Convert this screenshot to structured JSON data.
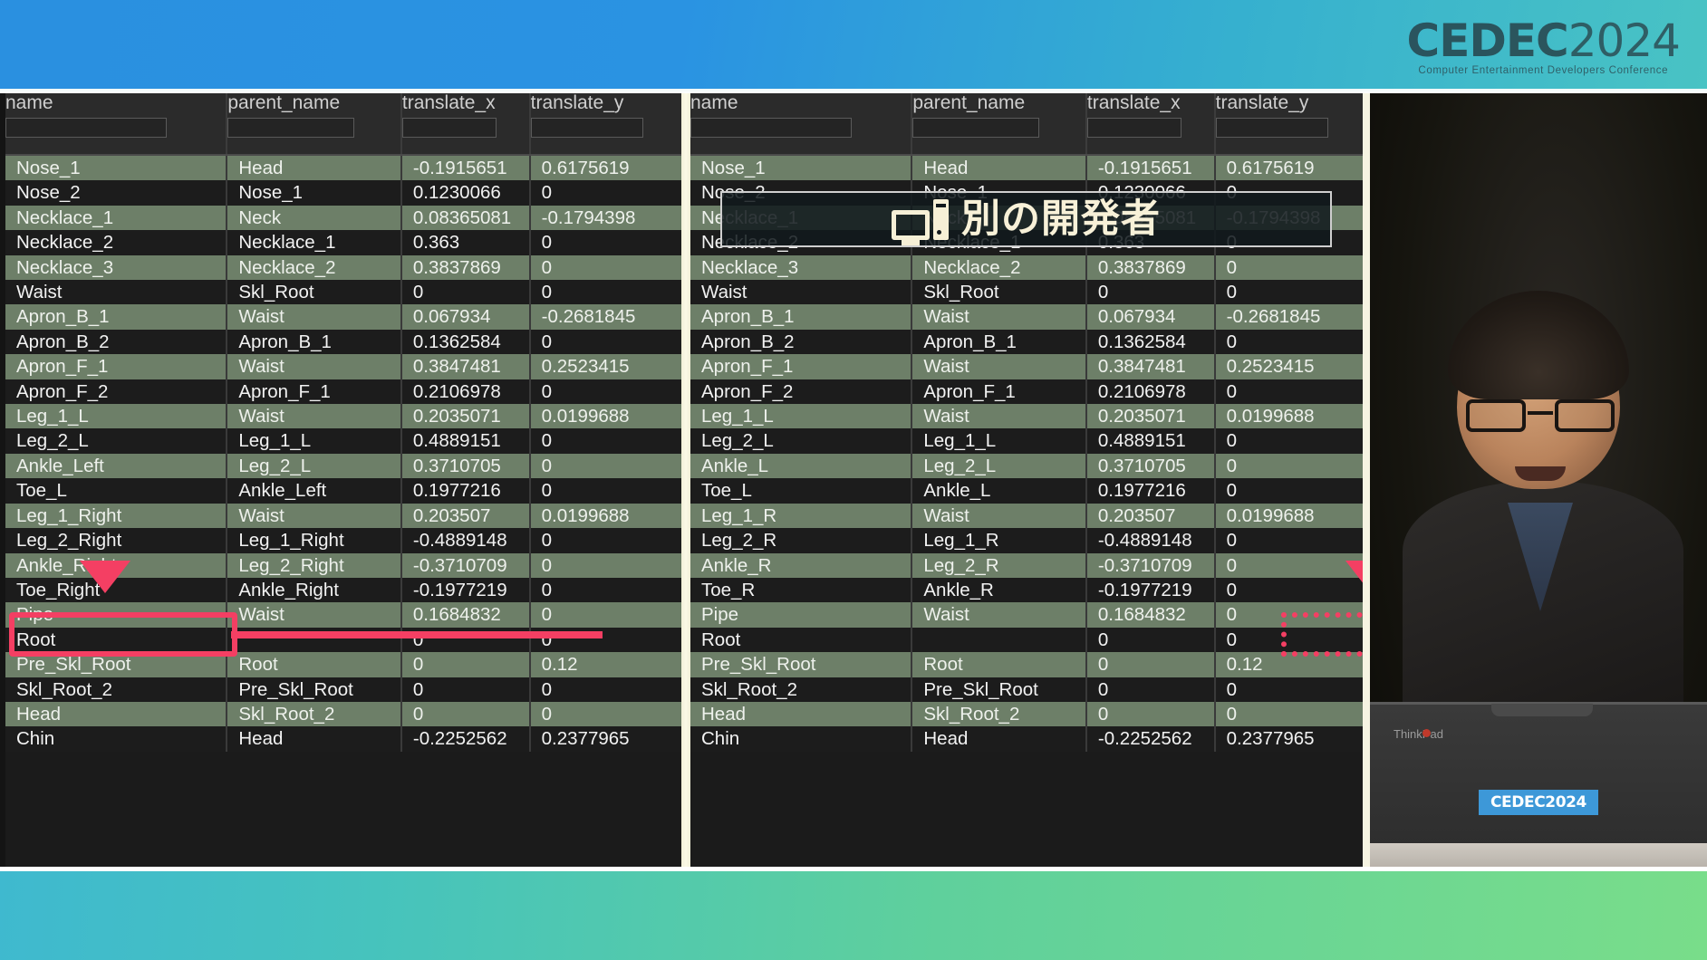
{
  "branding": {
    "logo_main": "CEDEC",
    "logo_year": "2024",
    "logo_tagline": "Computer Entertainment Developers Conference",
    "watermark_main": "CEDEC",
    "watermark_year": "2024",
    "watermark_tagline": "Computer Entertainment Developers Conference",
    "laptop_sticker": "CEDEC2024",
    "laptop_brand": "ThinkPad",
    "accent_red": "#f43f63",
    "top_bar_color": "#2a90e0",
    "bottom_bar_color": "#6fd691",
    "row_green": "#6d7f68",
    "row_dark": "#1c1c1c"
  },
  "overlay": {
    "icon": "desktop-computer-icon",
    "label": "別の開発者"
  },
  "table": {
    "columns": [
      "name",
      "parent_name",
      "translate_x",
      "translate_y"
    ],
    "filter_values": [
      "",
      "",
      "",
      ""
    ],
    "filter_placeholder": ""
  },
  "left_table": {
    "rows": [
      [
        "Nose_1",
        "Head",
        "-0.1915651",
        "0.6175619"
      ],
      [
        "Nose_2",
        "Nose_1",
        "0.1230066",
        "0"
      ],
      [
        "Necklace_1",
        "Neck",
        "0.08365081",
        "-0.1794398"
      ],
      [
        "Necklace_2",
        "Necklace_1",
        "0.363",
        "0"
      ],
      [
        "Necklace_3",
        "Necklace_2",
        "0.3837869",
        "0"
      ],
      [
        "Waist",
        "Skl_Root",
        "0",
        "0"
      ],
      [
        "Apron_B_1",
        "Waist",
        "0.067934",
        "-0.2681845"
      ],
      [
        "Apron_B_2",
        "Apron_B_1",
        "0.1362584",
        "0"
      ],
      [
        "Apron_F_1",
        "Waist",
        "0.3847481",
        "0.2523415"
      ],
      [
        "Apron_F_2",
        "Apron_F_1",
        "0.2106978",
        "0"
      ],
      [
        "Leg_1_L",
        "Waist",
        "0.2035071",
        "0.0199688"
      ],
      [
        "Leg_2_L",
        "Leg_1_L",
        "0.4889151",
        "0"
      ],
      [
        "Ankle_Left",
        "Leg_2_L",
        "0.3710705",
        "0"
      ],
      [
        "Toe_L",
        "Ankle_Left",
        "0.1977216",
        "0"
      ],
      [
        "Leg_1_Right",
        "Waist",
        "0.203507",
        "0.0199688"
      ],
      [
        "Leg_2_Right",
        "Leg_1_Right",
        "-0.4889148",
        "0"
      ],
      [
        "Ankle_Right",
        "Leg_2_Right",
        "-0.3710709",
        "0"
      ],
      [
        "Toe_Right",
        "Ankle_Right",
        "-0.1977219",
        "0"
      ],
      [
        "Pipe",
        "Waist",
        "0.1684832",
        "0"
      ],
      [
        "Root",
        "",
        "0",
        "0"
      ],
      [
        "Pre_Skl_Root",
        "Root",
        "0",
        "0.12"
      ],
      [
        "Skl_Root_2",
        "Pre_Skl_Root",
        "0",
        "0"
      ],
      [
        "Head",
        "Skl_Root_2",
        "0",
        "0"
      ],
      [
        "Chin",
        "Head",
        "-0.2252562",
        "0.2377965"
      ]
    ],
    "highlighted_row": "Ankle_Left"
  },
  "right_table": {
    "rows": [
      [
        "Nose_1",
        "Head",
        "-0.1915651",
        "0.6175619"
      ],
      [
        "Nose_2",
        "Nose_1",
        "0.1230066",
        "0"
      ],
      [
        "Necklace_1",
        "Neck",
        "0.08365081",
        "-0.1794398"
      ],
      [
        "Necklace_2",
        "Necklace_1",
        "0.363",
        "0"
      ],
      [
        "Necklace_3",
        "Necklace_2",
        "0.3837869",
        "0"
      ],
      [
        "Waist",
        "Skl_Root",
        "0",
        "0"
      ],
      [
        "Apron_B_1",
        "Waist",
        "0.067934",
        "-0.2681845"
      ],
      [
        "Apron_B_2",
        "Apron_B_1",
        "0.1362584",
        "0"
      ],
      [
        "Apron_F_1",
        "Waist",
        "0.3847481",
        "0.2523415"
      ],
      [
        "Apron_F_2",
        "Apron_F_1",
        "0.2106978",
        "0"
      ],
      [
        "Leg_1_L",
        "Waist",
        "0.2035071",
        "0.0199688"
      ],
      [
        "Leg_2_L",
        "Leg_1_L",
        "0.4889151",
        "0"
      ],
      [
        "Ankle_L",
        "Leg_2_L",
        "0.3710705",
        "0"
      ],
      [
        "Toe_L",
        "Ankle_L",
        "0.1977216",
        "0"
      ],
      [
        "Leg_1_R",
        "Waist",
        "0.203507",
        "0.0199688"
      ],
      [
        "Leg_2_R",
        "Leg_1_R",
        "-0.4889148",
        "0"
      ],
      [
        "Ankle_R",
        "Leg_2_R",
        "-0.3710709",
        "0"
      ],
      [
        "Toe_R",
        "Ankle_R",
        "-0.1977219",
        "0"
      ],
      [
        "Pipe",
        "Waist",
        "0.1684832",
        "0"
      ],
      [
        "Root",
        "",
        "0",
        "0"
      ],
      [
        "Pre_Skl_Root",
        "Root",
        "0",
        "0.12"
      ],
      [
        "Skl_Root_2",
        "Pre_Skl_Root",
        "0",
        "0"
      ],
      [
        "Head",
        "Skl_Root_2",
        "0",
        "0"
      ],
      [
        "Chin",
        "Head",
        "-0.2252562",
        "0.2377965"
      ]
    ],
    "highlighted_row": "Ankle_L"
  }
}
